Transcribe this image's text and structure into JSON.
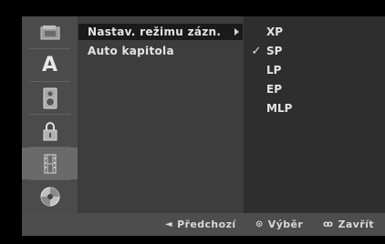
{
  "sidebar": {
    "items": [
      {
        "icon": "film-reel-icon"
      },
      {
        "icon": "letter-a-icon",
        "glyph": "A"
      },
      {
        "icon": "speaker-icon"
      },
      {
        "icon": "padlock-icon"
      },
      {
        "icon": "film-strip-icon"
      },
      {
        "icon": "disc-icon"
      }
    ],
    "selected_index": 4
  },
  "menu": {
    "items": [
      {
        "label": "Nastav. režimu zázn.",
        "selected": true,
        "has_submenu": true
      },
      {
        "label": "Auto kapitola",
        "selected": false,
        "has_submenu": false
      }
    ]
  },
  "options": {
    "items": [
      {
        "label": "XP",
        "checked": false
      },
      {
        "label": "SP",
        "checked": true
      },
      {
        "label": "LP",
        "checked": false
      },
      {
        "label": "EP",
        "checked": false
      },
      {
        "label": "MLP",
        "checked": false
      }
    ],
    "check_glyph": "✓"
  },
  "footer": {
    "prev_icon": "◄",
    "prev_label": "Předchozí",
    "select_icon": "⊙",
    "select_label": "Výběr",
    "close_icon": "ꝏ",
    "close_label": "Zavřít"
  },
  "colors": {
    "panel": "#3a3a3a",
    "sidebar": "#4b4b4b",
    "sidebar_selected": "#6a6a6a",
    "text": "#e4e4e4"
  }
}
